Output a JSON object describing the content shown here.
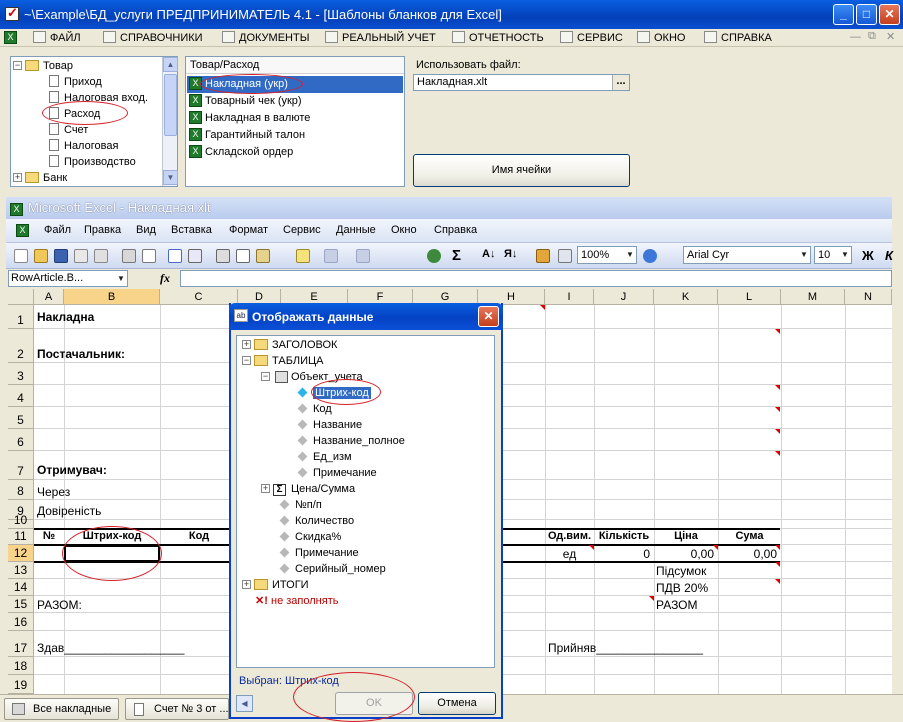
{
  "window": {
    "title": "~\\Example\\БД_услуги  ПРЕДПРИНИМАТЕЛЬ 4.1 - [Шаблоны бланков для Excel]",
    "minimize": "_",
    "maximize": "□",
    "close": "✕"
  },
  "main_menu": [
    "ФАЙЛ",
    "СПРАВОЧНИКИ",
    "ДОКУМЕНТЫ",
    "РЕАЛЬНЫЙ УЧЕТ",
    "ОТЧЕТНОСТЬ",
    "СЕРВИС",
    "ОКНО",
    "СПРАВКА"
  ],
  "left_tree": {
    "items": [
      {
        "label": "Товар",
        "type": "folder",
        "expander": "−"
      },
      {
        "label": "Приход",
        "type": "doc"
      },
      {
        "label": "Налоговая вход.",
        "type": "doc"
      },
      {
        "label": "Расход",
        "type": "doc"
      },
      {
        "label": "Счет",
        "type": "doc"
      },
      {
        "label": "Налоговая",
        "type": "doc"
      },
      {
        "label": "Производство",
        "type": "doc"
      },
      {
        "label": "Банк",
        "type": "folder",
        "expander": "+"
      }
    ]
  },
  "templates": {
    "header": "Товар/Расход",
    "items": [
      {
        "label": "Накладная (укр)",
        "selected": true
      },
      {
        "label": "Товарный чек (укр)",
        "selected": false
      },
      {
        "label": "Накладная в валюте",
        "selected": false
      },
      {
        "label": "Гарантийный талон",
        "selected": false
      },
      {
        "label": "Складской ордер",
        "selected": false
      }
    ]
  },
  "file": {
    "label": "Использовать файл:",
    "value": "Накладная.xlt",
    "browse": "..."
  },
  "cell_name_button": "Имя ячейки",
  "excel": {
    "title": "Microsoft Excel - Накладная.xlt",
    "menu": [
      "Файл",
      "Правка",
      "Вид",
      "Вставка",
      "Формат",
      "Сервис",
      "Данные",
      "Окно",
      "Справка"
    ],
    "zoom": "100%",
    "font": "Arial Cyr",
    "font_size": "10",
    "bold": "Ж",
    "italic": "К",
    "name_box": "RowArticle.B...",
    "fx": "fx",
    "columns": [
      "A",
      "B",
      "C",
      "D",
      "E",
      "F",
      "G",
      "H",
      "I",
      "J",
      "K",
      "L",
      "M",
      "N"
    ],
    "rows": [
      "1",
      "2",
      "3",
      "4",
      "5",
      "6",
      "7",
      "8",
      "9",
      "10",
      "11",
      "12",
      "13",
      "14",
      "15",
      "16",
      "17",
      "18",
      "19"
    ],
    "cells": {
      "r1": "Накладна",
      "r2": "Постачальник:",
      "r7": "Отримувач:",
      "r8": "Через",
      "r9": "Довіреність",
      "r15": "РАЗОМ:",
      "r17a": "Здав__________________",
      "r17i": "Прийняв________________"
    },
    "table_header": {
      "num": "№",
      "barcode": "Штрих-код",
      "code": "Код",
      "unit": "Од.вим.",
      "qty": "Кількість",
      "price": "Ціна",
      "sum": "Сума"
    },
    "row12": {
      "unit": "ед",
      "qty": "0",
      "price": "0,00",
      "sum": "0,00"
    },
    "totals": {
      "subtotal": "Підсумок",
      "vat": "ПДВ 20%",
      "total": "РАЗОМ"
    }
  },
  "taskbar": {
    "items": [
      "Все накладные",
      "Счет № 3 от ..."
    ]
  },
  "dialog": {
    "title": "Отображать данные",
    "close": "✕",
    "tree": {
      "heading": "ЗАГОЛОВОК",
      "table": "ТАБЛИЦА",
      "object": "Объект_учета",
      "fields": [
        "Штрих-код",
        "Код",
        "Название",
        "Название_полное",
        "Ед_изм",
        "Примечание"
      ],
      "price_sum": "Цена/Сумма",
      "row_fields": [
        "№п/п",
        "Количество",
        "Скидка%",
        "Примечание",
        "Серийный_номер"
      ],
      "totals": "ИТОГИ",
      "not_fill": "не заполнять"
    },
    "selected_label": "Выбран:",
    "selected_value": "Штрих-код",
    "ok": "OK",
    "cancel": "Отмена"
  }
}
